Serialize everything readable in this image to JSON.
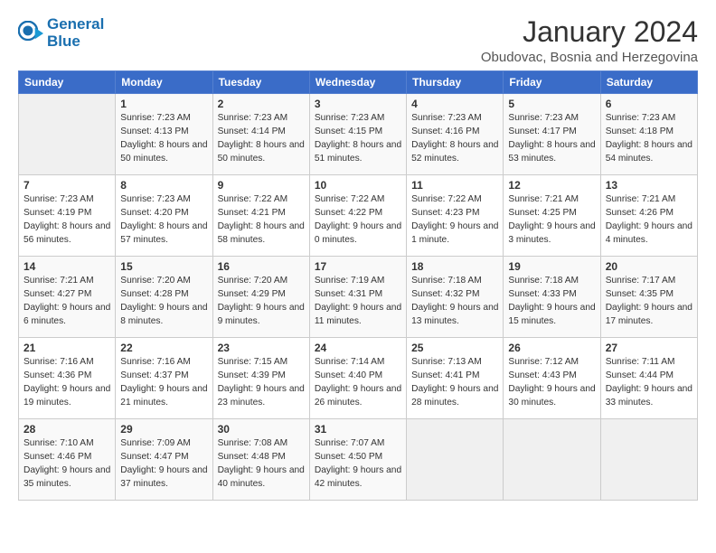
{
  "logo": {
    "line1": "General",
    "line2": "Blue"
  },
  "title": "January 2024",
  "subtitle": "Obudovac, Bosnia and Herzegovina",
  "days_header": [
    "Sunday",
    "Monday",
    "Tuesday",
    "Wednesday",
    "Thursday",
    "Friday",
    "Saturday"
  ],
  "weeks": [
    [
      {
        "day": "",
        "sunrise": "",
        "sunset": "",
        "daylight": ""
      },
      {
        "day": "1",
        "sunrise": "Sunrise: 7:23 AM",
        "sunset": "Sunset: 4:13 PM",
        "daylight": "Daylight: 8 hours and 50 minutes."
      },
      {
        "day": "2",
        "sunrise": "Sunrise: 7:23 AM",
        "sunset": "Sunset: 4:14 PM",
        "daylight": "Daylight: 8 hours and 50 minutes."
      },
      {
        "day": "3",
        "sunrise": "Sunrise: 7:23 AM",
        "sunset": "Sunset: 4:15 PM",
        "daylight": "Daylight: 8 hours and 51 minutes."
      },
      {
        "day": "4",
        "sunrise": "Sunrise: 7:23 AM",
        "sunset": "Sunset: 4:16 PM",
        "daylight": "Daylight: 8 hours and 52 minutes."
      },
      {
        "day": "5",
        "sunrise": "Sunrise: 7:23 AM",
        "sunset": "Sunset: 4:17 PM",
        "daylight": "Daylight: 8 hours and 53 minutes."
      },
      {
        "day": "6",
        "sunrise": "Sunrise: 7:23 AM",
        "sunset": "Sunset: 4:18 PM",
        "daylight": "Daylight: 8 hours and 54 minutes."
      }
    ],
    [
      {
        "day": "7",
        "sunrise": "Sunrise: 7:23 AM",
        "sunset": "Sunset: 4:19 PM",
        "daylight": "Daylight: 8 hours and 56 minutes."
      },
      {
        "day": "8",
        "sunrise": "Sunrise: 7:23 AM",
        "sunset": "Sunset: 4:20 PM",
        "daylight": "Daylight: 8 hours and 57 minutes."
      },
      {
        "day": "9",
        "sunrise": "Sunrise: 7:22 AM",
        "sunset": "Sunset: 4:21 PM",
        "daylight": "Daylight: 8 hours and 58 minutes."
      },
      {
        "day": "10",
        "sunrise": "Sunrise: 7:22 AM",
        "sunset": "Sunset: 4:22 PM",
        "daylight": "Daylight: 9 hours and 0 minutes."
      },
      {
        "day": "11",
        "sunrise": "Sunrise: 7:22 AM",
        "sunset": "Sunset: 4:23 PM",
        "daylight": "Daylight: 9 hours and 1 minute."
      },
      {
        "day": "12",
        "sunrise": "Sunrise: 7:21 AM",
        "sunset": "Sunset: 4:25 PM",
        "daylight": "Daylight: 9 hours and 3 minutes."
      },
      {
        "day": "13",
        "sunrise": "Sunrise: 7:21 AM",
        "sunset": "Sunset: 4:26 PM",
        "daylight": "Daylight: 9 hours and 4 minutes."
      }
    ],
    [
      {
        "day": "14",
        "sunrise": "Sunrise: 7:21 AM",
        "sunset": "Sunset: 4:27 PM",
        "daylight": "Daylight: 9 hours and 6 minutes."
      },
      {
        "day": "15",
        "sunrise": "Sunrise: 7:20 AM",
        "sunset": "Sunset: 4:28 PM",
        "daylight": "Daylight: 9 hours and 8 minutes."
      },
      {
        "day": "16",
        "sunrise": "Sunrise: 7:20 AM",
        "sunset": "Sunset: 4:29 PM",
        "daylight": "Daylight: 9 hours and 9 minutes."
      },
      {
        "day": "17",
        "sunrise": "Sunrise: 7:19 AM",
        "sunset": "Sunset: 4:31 PM",
        "daylight": "Daylight: 9 hours and 11 minutes."
      },
      {
        "day": "18",
        "sunrise": "Sunrise: 7:18 AM",
        "sunset": "Sunset: 4:32 PM",
        "daylight": "Daylight: 9 hours and 13 minutes."
      },
      {
        "day": "19",
        "sunrise": "Sunrise: 7:18 AM",
        "sunset": "Sunset: 4:33 PM",
        "daylight": "Daylight: 9 hours and 15 minutes."
      },
      {
        "day": "20",
        "sunrise": "Sunrise: 7:17 AM",
        "sunset": "Sunset: 4:35 PM",
        "daylight": "Daylight: 9 hours and 17 minutes."
      }
    ],
    [
      {
        "day": "21",
        "sunrise": "Sunrise: 7:16 AM",
        "sunset": "Sunset: 4:36 PM",
        "daylight": "Daylight: 9 hours and 19 minutes."
      },
      {
        "day": "22",
        "sunrise": "Sunrise: 7:16 AM",
        "sunset": "Sunset: 4:37 PM",
        "daylight": "Daylight: 9 hours and 21 minutes."
      },
      {
        "day": "23",
        "sunrise": "Sunrise: 7:15 AM",
        "sunset": "Sunset: 4:39 PM",
        "daylight": "Daylight: 9 hours and 23 minutes."
      },
      {
        "day": "24",
        "sunrise": "Sunrise: 7:14 AM",
        "sunset": "Sunset: 4:40 PM",
        "daylight": "Daylight: 9 hours and 26 minutes."
      },
      {
        "day": "25",
        "sunrise": "Sunrise: 7:13 AM",
        "sunset": "Sunset: 4:41 PM",
        "daylight": "Daylight: 9 hours and 28 minutes."
      },
      {
        "day": "26",
        "sunrise": "Sunrise: 7:12 AM",
        "sunset": "Sunset: 4:43 PM",
        "daylight": "Daylight: 9 hours and 30 minutes."
      },
      {
        "day": "27",
        "sunrise": "Sunrise: 7:11 AM",
        "sunset": "Sunset: 4:44 PM",
        "daylight": "Daylight: 9 hours and 33 minutes."
      }
    ],
    [
      {
        "day": "28",
        "sunrise": "Sunrise: 7:10 AM",
        "sunset": "Sunset: 4:46 PM",
        "daylight": "Daylight: 9 hours and 35 minutes."
      },
      {
        "day": "29",
        "sunrise": "Sunrise: 7:09 AM",
        "sunset": "Sunset: 4:47 PM",
        "daylight": "Daylight: 9 hours and 37 minutes."
      },
      {
        "day": "30",
        "sunrise": "Sunrise: 7:08 AM",
        "sunset": "Sunset: 4:48 PM",
        "daylight": "Daylight: 9 hours and 40 minutes."
      },
      {
        "day": "31",
        "sunrise": "Sunrise: 7:07 AM",
        "sunset": "Sunset: 4:50 PM",
        "daylight": "Daylight: 9 hours and 42 minutes."
      },
      {
        "day": "",
        "sunrise": "",
        "sunset": "",
        "daylight": ""
      },
      {
        "day": "",
        "sunrise": "",
        "sunset": "",
        "daylight": ""
      },
      {
        "day": "",
        "sunrise": "",
        "sunset": "",
        "daylight": ""
      }
    ]
  ]
}
